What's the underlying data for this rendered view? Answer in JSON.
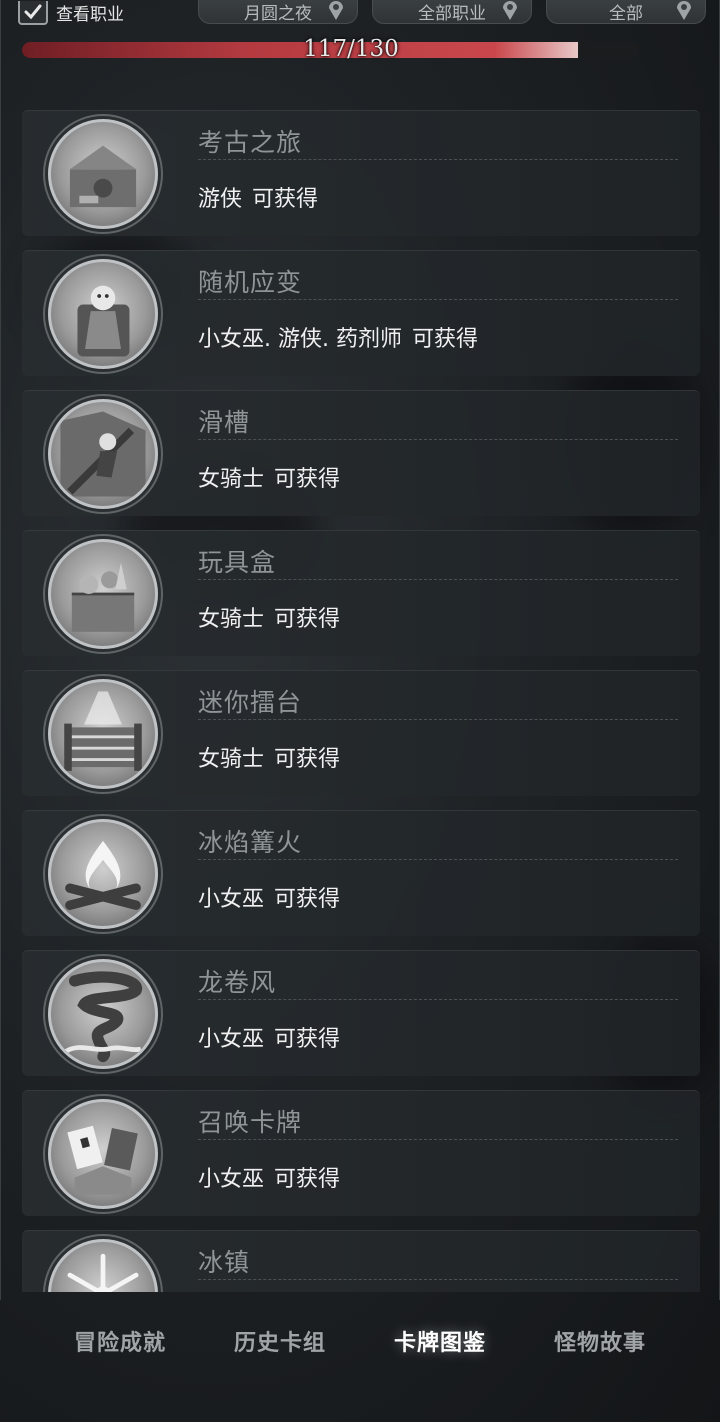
{
  "filters": {
    "show_class_label": "查看职业",
    "show_class_checked": true,
    "dropdown_1": "月圆之夜",
    "dropdown_2": "全部职业",
    "dropdown_3": "全部"
  },
  "progress": {
    "text": "117/130",
    "value": 117,
    "max": 130
  },
  "available_label": "可获得",
  "cards": [
    {
      "title": "考古之旅",
      "classes": "游侠",
      "available": "可获得",
      "icon": "archaeology-icon"
    },
    {
      "title": "随机应变",
      "classes": "小女巫. 游侠. 药剂师",
      "available": "可获得",
      "icon": "witch-chair-icon"
    },
    {
      "title": "滑槽",
      "classes": "女骑士",
      "available": "可获得",
      "icon": "chute-icon"
    },
    {
      "title": "玩具盒",
      "classes": "女骑士",
      "available": "可获得",
      "icon": "toybox-icon"
    },
    {
      "title": "迷你擂台",
      "classes": "女骑士",
      "available": "可获得",
      "icon": "boxing-ring-icon"
    },
    {
      "title": "冰焰篝火",
      "classes": "小女巫",
      "available": "可获得",
      "icon": "bonfire-icon"
    },
    {
      "title": "龙卷风",
      "classes": "小女巫",
      "available": "可获得",
      "icon": "tornado-icon"
    },
    {
      "title": "召唤卡牌",
      "classes": "小女巫",
      "available": "可获得",
      "icon": "summon-cards-icon"
    },
    {
      "title": "冰镇",
      "classes": "",
      "available": "",
      "icon": "snowflake-icon"
    }
  ],
  "tabs": [
    {
      "label": "冒险成就",
      "active": false
    },
    {
      "label": "历史卡组",
      "active": false
    },
    {
      "label": "卡牌图鉴",
      "active": true
    },
    {
      "label": "怪物故事",
      "active": false
    }
  ],
  "colors": {
    "progress": "#b33a40",
    "background": "#1e2225"
  }
}
